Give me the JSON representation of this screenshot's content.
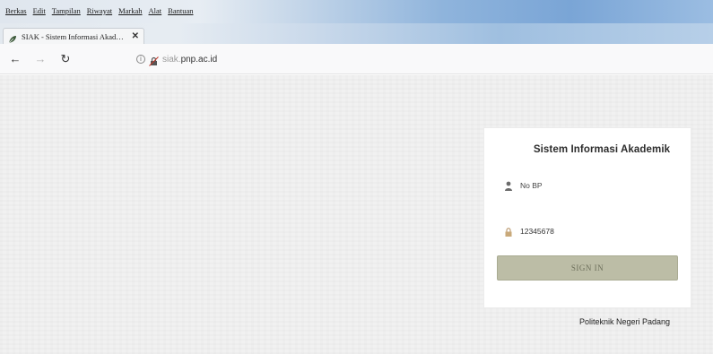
{
  "browser": {
    "menu": [
      "Berkas",
      "Edit",
      "Tampilan",
      "Riwayat",
      "Markah",
      "Alat",
      "Bantuan"
    ],
    "tab": {
      "title": "SIAK - Sistem Informasi Akad…",
      "close_glyph": "✕",
      "favicon": "leaf-icon"
    },
    "nav": {
      "back_glyph": "←",
      "forward_glyph": "→",
      "reload_glyph": "↻"
    },
    "url": {
      "prefix": "siak.",
      "domain": "pnp.ac.id"
    }
  },
  "login": {
    "title": "Sistem Informasi Akademik",
    "username_placeholder": "No BP",
    "username_icon": "user-icon",
    "password_value": "12345678",
    "password_icon": "lock-icon",
    "signin_label": "SIGN IN",
    "signin_color": "#bcbda6"
  },
  "footer": {
    "text": "Politeknik Negeri Padang"
  }
}
